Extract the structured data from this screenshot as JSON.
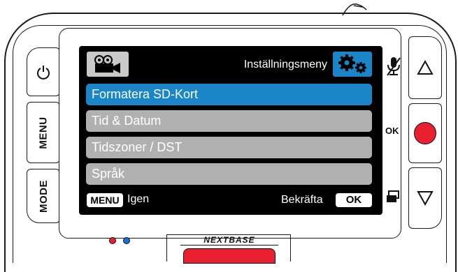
{
  "brand": "NEXTBASE",
  "header": {
    "title": "Inställningsmeny",
    "left_icon": "video-camera-icon",
    "right_icon": "settings-gears-icon"
  },
  "menu": {
    "items": [
      {
        "label": "Formatera SD-Kort",
        "selected": true
      },
      {
        "label": "Tid & Datum",
        "selected": false
      },
      {
        "label": "Tidszoner / DST",
        "selected": false
      },
      {
        "label": "Språk",
        "selected": false
      }
    ]
  },
  "footer": {
    "menu_key": "MENU",
    "back_label": "Igen",
    "confirm_label": "Bekräfta",
    "ok_key": "OK"
  },
  "buttons": {
    "menu": "MENU",
    "mode": "MODE",
    "ok": "OK"
  },
  "colors": {
    "selected": "#1a86c7",
    "item": "#b0b0b0",
    "record": "#e8202f",
    "led_red": "#e8202f",
    "led_blue": "#1a6fd0"
  }
}
